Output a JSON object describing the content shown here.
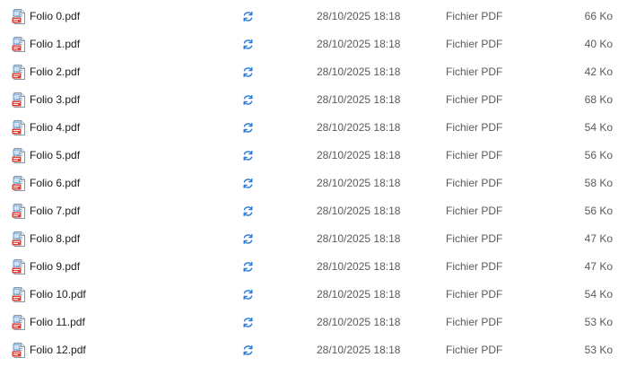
{
  "colors": {
    "sync_icon": "#2b79d6",
    "pdf_badge": "#d9443a",
    "text_primary": "#1a1a1a",
    "text_secondary": "#5a5a5a"
  },
  "icons": {
    "file": "pdf-file-icon",
    "status": "sync-pending-icon"
  },
  "files": [
    {
      "name": "Folio 0.pdf",
      "modified": "28/10/2025 18:18",
      "type": "Fichier PDF",
      "size": "66 Ko"
    },
    {
      "name": "Folio 1.pdf",
      "modified": "28/10/2025 18:18",
      "type": "Fichier PDF",
      "size": "40 Ko"
    },
    {
      "name": "Folio 2.pdf",
      "modified": "28/10/2025 18:18",
      "type": "Fichier PDF",
      "size": "42 Ko"
    },
    {
      "name": "Folio 3.pdf",
      "modified": "28/10/2025 18:18",
      "type": "Fichier PDF",
      "size": "68 Ko"
    },
    {
      "name": "Folio 4.pdf",
      "modified": "28/10/2025 18:18",
      "type": "Fichier PDF",
      "size": "54 Ko"
    },
    {
      "name": "Folio 5.pdf",
      "modified": "28/10/2025 18:18",
      "type": "Fichier PDF",
      "size": "56 Ko"
    },
    {
      "name": "Folio 6.pdf",
      "modified": "28/10/2025 18:18",
      "type": "Fichier PDF",
      "size": "58 Ko"
    },
    {
      "name": "Folio 7.pdf",
      "modified": "28/10/2025 18:18",
      "type": "Fichier PDF",
      "size": "56 Ko"
    },
    {
      "name": "Folio 8.pdf",
      "modified": "28/10/2025 18:18",
      "type": "Fichier PDF",
      "size": "47 Ko"
    },
    {
      "name": "Folio 9.pdf",
      "modified": "28/10/2025 18:18",
      "type": "Fichier PDF",
      "size": "47 Ko"
    },
    {
      "name": "Folio 10.pdf",
      "modified": "28/10/2025 18:18",
      "type": "Fichier PDF",
      "size": "54 Ko"
    },
    {
      "name": "Folio 11.pdf",
      "modified": "28/10/2025 18:18",
      "type": "Fichier PDF",
      "size": "53 Ko"
    },
    {
      "name": "Folio 12.pdf",
      "modified": "28/10/2025 18:18",
      "type": "Fichier PDF",
      "size": "53 Ko"
    }
  ]
}
